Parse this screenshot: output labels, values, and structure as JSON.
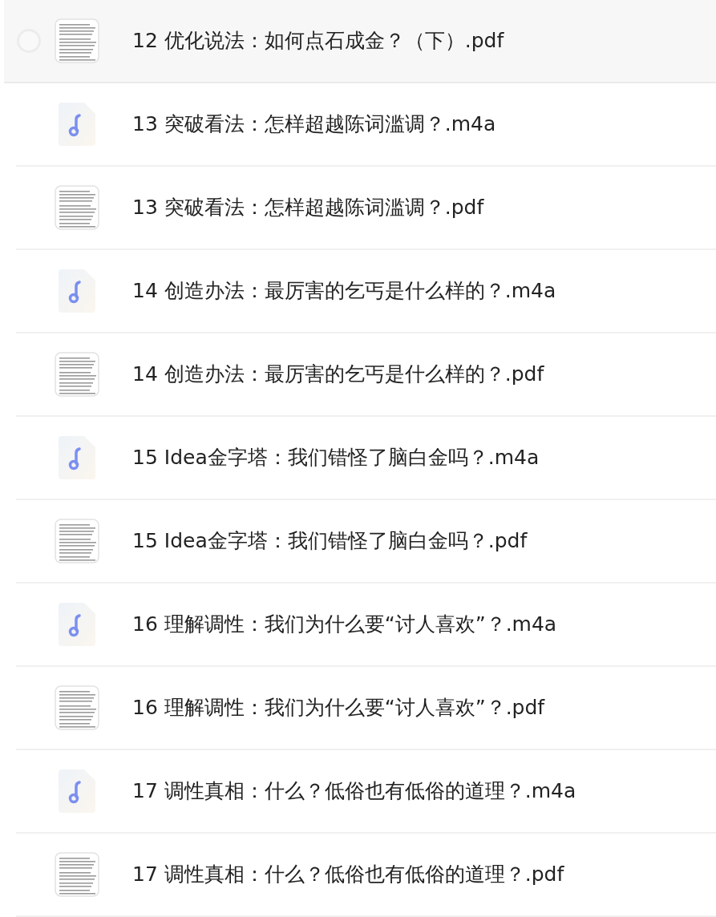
{
  "files": [
    {
      "name": "12 优化说法：如何点石成金？（下）.pdf",
      "kind": "pdf",
      "hovered": true
    },
    {
      "name": "13 突破看法：怎样超越陈词滥调？.m4a",
      "kind": "audio",
      "hovered": false
    },
    {
      "name": "13 突破看法：怎样超越陈词滥调？.pdf",
      "kind": "pdf",
      "hovered": false
    },
    {
      "name": "14 创造办法：最厉害的乞丐是什么样的？.m4a",
      "kind": "audio",
      "hovered": false
    },
    {
      "name": "14 创造办法：最厉害的乞丐是什么样的？.pdf",
      "kind": "pdf",
      "hovered": false
    },
    {
      "name": "15 Idea金字塔：我们错怪了脑白金吗？.m4a",
      "kind": "audio",
      "hovered": false
    },
    {
      "name": "15 Idea金字塔：我们错怪了脑白金吗？.pdf",
      "kind": "pdf",
      "hovered": false
    },
    {
      "name": "16 理解调性：我们为什么要“讨人喜欢”？.m4a",
      "kind": "audio",
      "hovered": false
    },
    {
      "name": "16 理解调性：我们为什么要“讨人喜欢”？.pdf",
      "kind": "pdf",
      "hovered": false
    },
    {
      "name": "17 调性真相：什么？低俗也有低俗的道理？.m4a",
      "kind": "audio",
      "hovered": false
    },
    {
      "name": "17 调性真相：什么？低俗也有低俗的道理？.pdf",
      "kind": "pdf",
      "hovered": false
    }
  ]
}
